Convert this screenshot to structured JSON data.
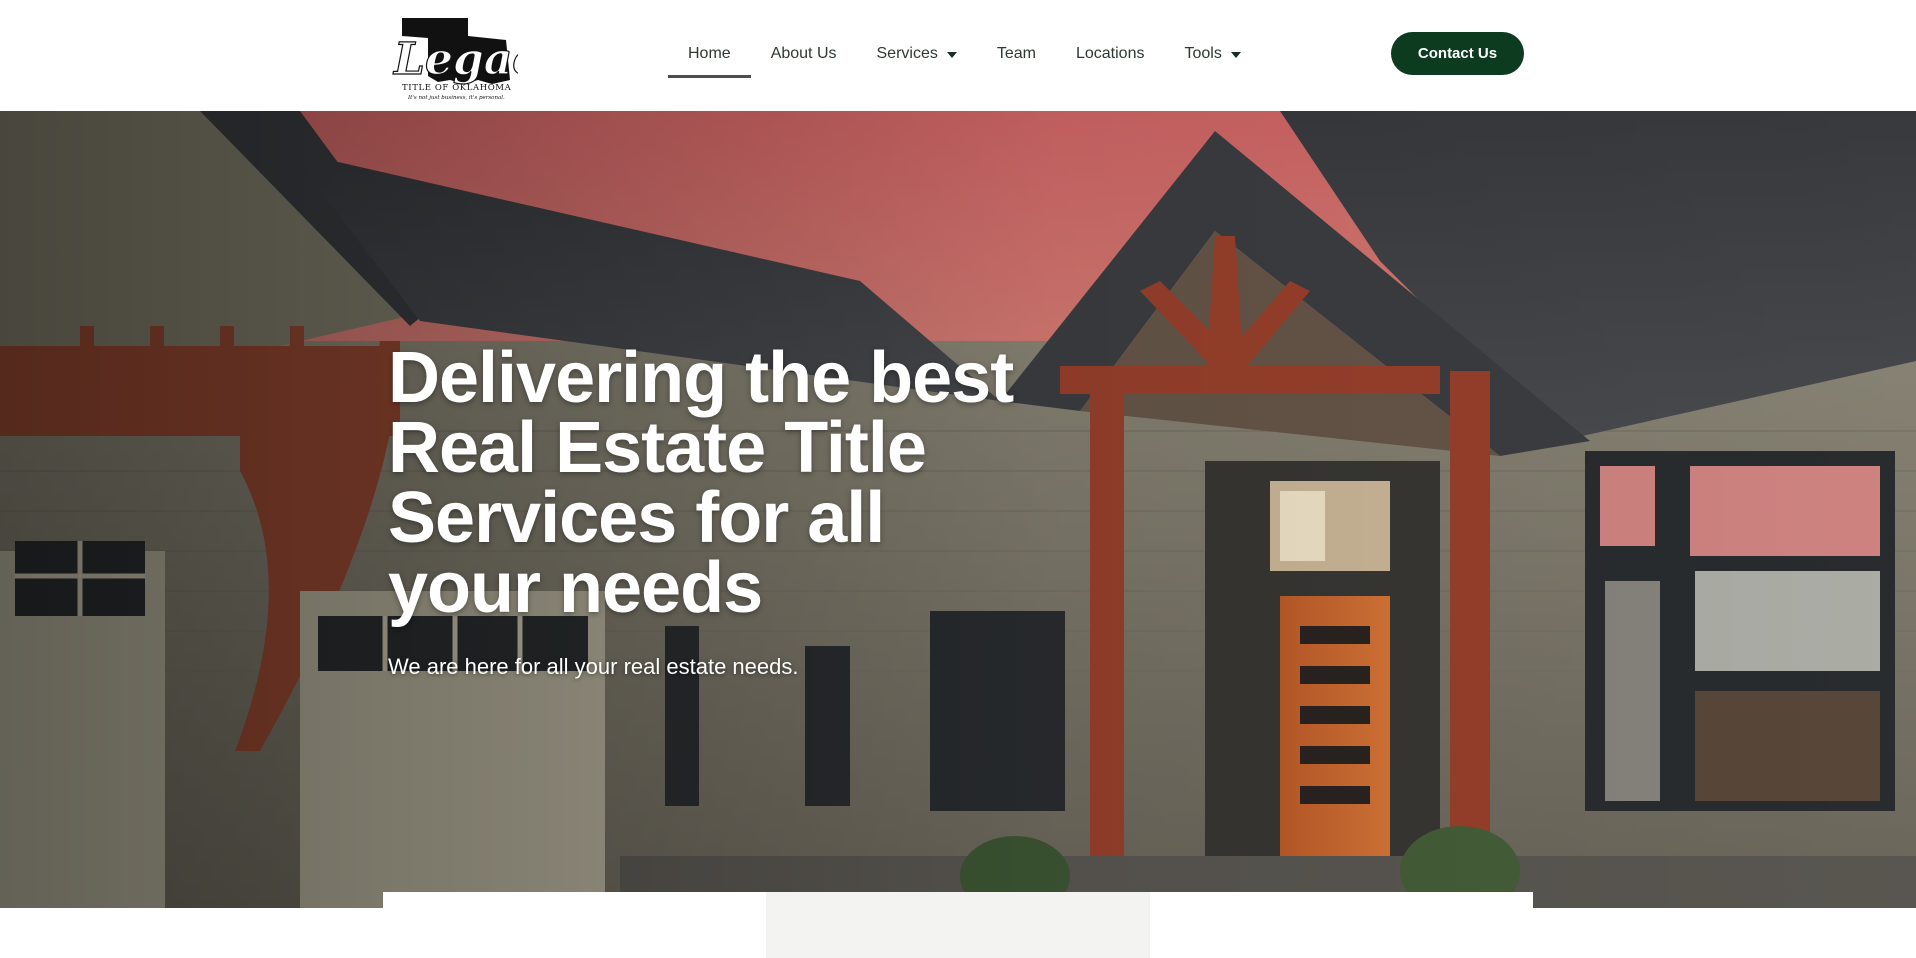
{
  "brand": {
    "logo_name": "Legacy",
    "logo_line1": "TITLE OF OKLAHOMA",
    "logo_tagline": "It's not just business, it's personal.",
    "accent_color": "#0d3b20"
  },
  "nav": {
    "items": [
      {
        "label": "Home",
        "active": true,
        "dropdown": false
      },
      {
        "label": "About Us",
        "active": false,
        "dropdown": false
      },
      {
        "label": "Services",
        "active": false,
        "dropdown": true
      },
      {
        "label": "Team",
        "active": false,
        "dropdown": false
      },
      {
        "label": "Locations",
        "active": false,
        "dropdown": false
      },
      {
        "label": "Tools",
        "active": false,
        "dropdown": true
      }
    ],
    "cta_label": "Contact Us"
  },
  "hero": {
    "title": "Delivering the best Real Estate Title Services for all your needs",
    "subtitle": "We are here for all your real estate needs.",
    "image": "house-exterior-image"
  }
}
